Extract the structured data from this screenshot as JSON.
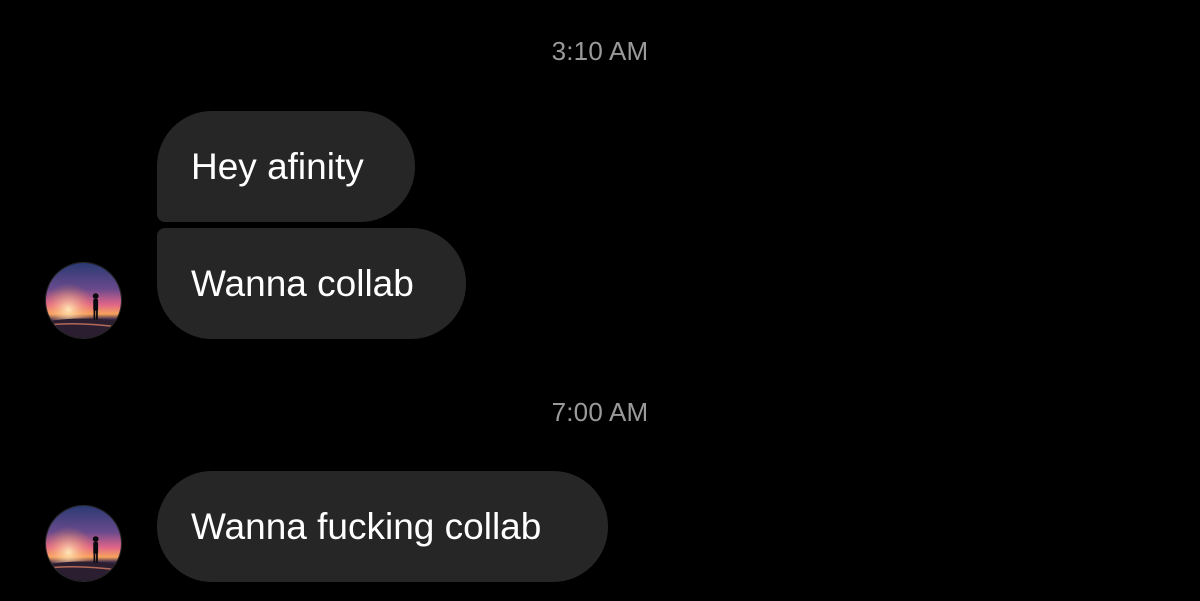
{
  "conversation": {
    "groups": [
      {
        "timestamp": "3:10 AM",
        "messages": [
          {
            "text": "Hey afinity"
          },
          {
            "text": "Wanna collab"
          }
        ],
        "avatar_icon": "sunset-silhouette-avatar"
      },
      {
        "timestamp": "7:00 AM",
        "messages": [
          {
            "text": "Wanna fucking collab"
          }
        ],
        "avatar_icon": "sunset-silhouette-avatar"
      }
    ]
  },
  "colors": {
    "background": "#000000",
    "bubble": "#262626",
    "timestamp_text": "#9a9a9a",
    "message_text": "#ffffff"
  }
}
